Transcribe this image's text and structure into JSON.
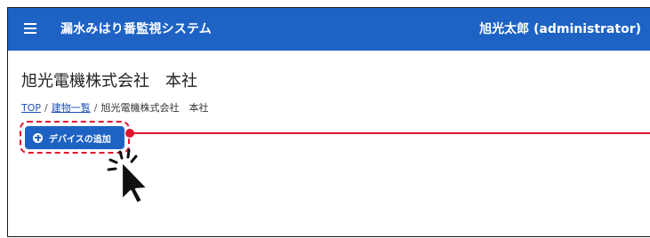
{
  "header": {
    "menu_icon": "hamburger-menu-icon",
    "app_title": "漏水みはり番監視システム",
    "user": "旭光太郎 (administrator)",
    "background_color": "#1e63c4"
  },
  "page": {
    "title": "旭光電機株式会社　本社"
  },
  "breadcrumb": {
    "items": [
      {
        "label": "TOP",
        "link": true
      },
      {
        "label": "建物一覧",
        "link": true
      },
      {
        "label": "旭光電機株式会社　本社",
        "link": false
      }
    ],
    "separator": "/"
  },
  "actions": {
    "add_device_label": "デバイスの追加",
    "add_device_icon": "plus-circle-icon"
  },
  "annotation": {
    "color": "#e0142d",
    "cursor_icon": "click-pointer-icon"
  }
}
